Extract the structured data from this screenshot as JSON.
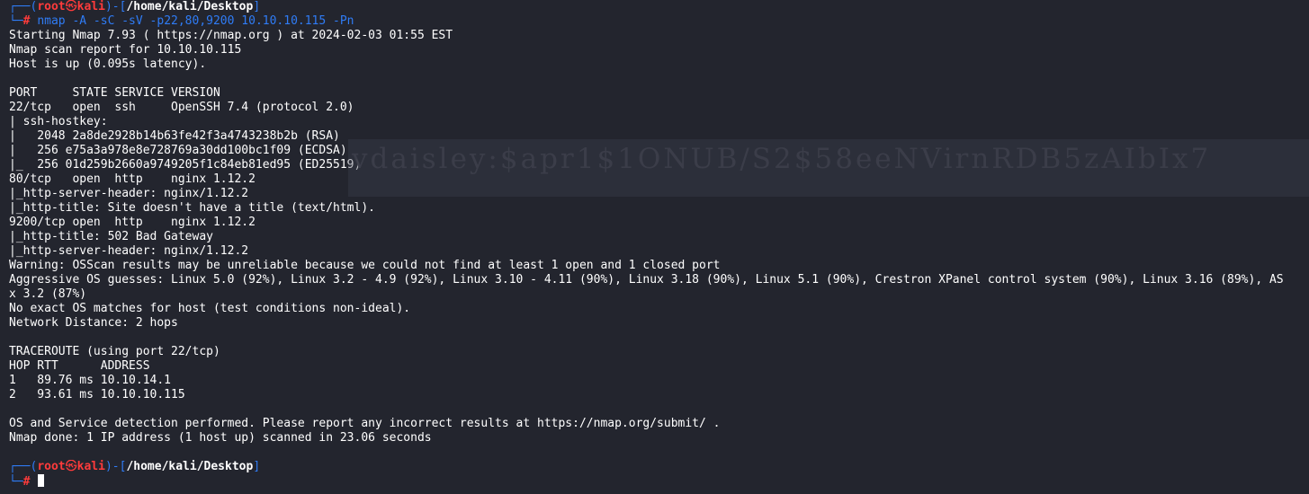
{
  "prompt": {
    "user": "root",
    "host": "kali",
    "cwd": "/home/kali/Desktop",
    "symbol": "#"
  },
  "command": "nmap -A -sC -sV -p22,80,9200 10.10.10.115 -Pn",
  "output": [
    "Starting Nmap 7.93 ( https://nmap.org ) at 2024-02-03 01:55 EST",
    "Nmap scan report for 10.10.10.115",
    "Host is up (0.095s latency).",
    "",
    "PORT     STATE SERVICE VERSION",
    "22/tcp   open  ssh     OpenSSH 7.4 (protocol 2.0)",
    "| ssh-hostkey: ",
    "|   2048 2a8de2928b14b63fe42f3a4743238b2b (RSA)",
    "|   256 e75a3a978e8e728769a30dd100bc1f09 (ECDSA)",
    "|_  256 01d259b2660a9749205f1c84eb81ed95 (ED25519)",
    "80/tcp   open  http    nginx 1.12.2",
    "|_http-server-header: nginx/1.12.2",
    "|_http-title: Site doesn't have a title (text/html).",
    "9200/tcp open  http    nginx 1.12.2",
    "|_http-title: 502 Bad Gateway",
    "|_http-server-header: nginx/1.12.2",
    "Warning: OSScan results may be unreliable because we could not find at least 1 open and 1 closed port",
    "Aggressive OS guesses: Linux 5.0 (92%), Linux 3.2 - 4.9 (92%), Linux 3.10 - 4.11 (90%), Linux 3.18 (90%), Linux 5.1 (90%), Crestron XPanel control system (90%), Linux 3.16 (89%), AS",
    "x 3.2 (87%)",
    "No exact OS matches for host (test conditions non-ideal).",
    "Network Distance: 2 hops",
    "",
    "TRACEROUTE (using port 22/tcp)",
    "HOP RTT      ADDRESS",
    "1   89.76 ms 10.10.14.1",
    "2   93.61 ms 10.10.10.115",
    "",
    "OS and Service detection performed. Please report any incorrect results at https://nmap.org/submit/ .",
    "Nmap done: 1 IP address (1 host up) scanned in 23.06 seconds",
    ""
  ],
  "overlay_text": "vdaisley:$apr1$1ONUB/S2$58eeNVirnRDB5zAIbIx7",
  "colors": {
    "background": "#23252e",
    "prompt_frame": "#2f7cf6",
    "user_host": "#ff3b3b",
    "text": "#ffffff"
  }
}
